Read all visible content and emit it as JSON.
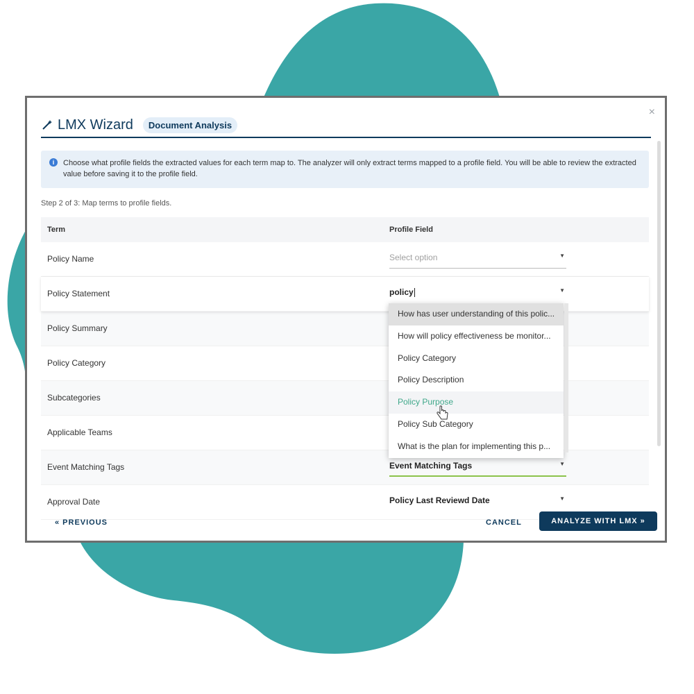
{
  "wizard": {
    "title": "LMX Wizard",
    "badge": "Document Analysis",
    "close": "×",
    "info_text": "Choose what profile fields the extracted values for each term map to. The analyzer will only extract terms mapped to a profile field. You will be able to review the extracted value before saving it to the profile field.",
    "step": "Step 2 of 3: Map terms to profile fields."
  },
  "table": {
    "col_term": "Term",
    "col_field": "Profile Field",
    "rows": [
      {
        "term": "Policy Name",
        "placeholder": "Select option"
      },
      {
        "term": "Policy Statement",
        "value": "policy"
      },
      {
        "term": "Policy Summary"
      },
      {
        "term": "Policy Category"
      },
      {
        "term": "Subcategories"
      },
      {
        "term": "Applicable Teams"
      },
      {
        "term": "Event Matching Tags",
        "value": "Event Matching Tags"
      },
      {
        "term": "Approval Date",
        "value": "Policy Last Reviewd Date"
      }
    ]
  },
  "dropdown": {
    "options": [
      "How has user understanding of this polic...",
      "How will policy effectiveness be monitor...",
      "Policy Category",
      "Policy Description",
      "Policy Purpose",
      "Policy Sub Category",
      "What is the plan for implementing this p..."
    ],
    "hovered": "Policy Purpose"
  },
  "footer": {
    "previous": "« PREVIOUS",
    "cancel": "CANCEL",
    "analyze": "ANALYZE WITH LMX »"
  },
  "colors": {
    "brand": "#0e3a5c",
    "blob": "#3aa6a6",
    "hover_text": "#3fa88a",
    "focus_underline": "#8bc34a"
  }
}
